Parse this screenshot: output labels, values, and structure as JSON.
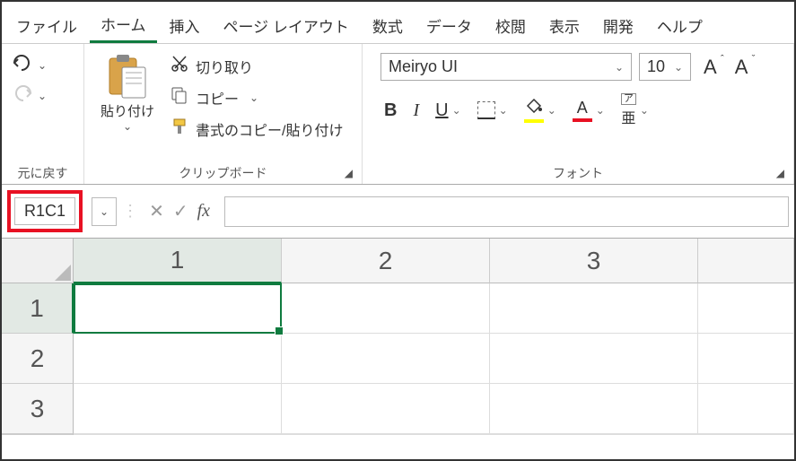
{
  "menubar": {
    "items": [
      {
        "label": "ファイル"
      },
      {
        "label": "ホーム",
        "active": true
      },
      {
        "label": "挿入"
      },
      {
        "label": "ページ レイアウト"
      },
      {
        "label": "数式"
      },
      {
        "label": "データ"
      },
      {
        "label": "校閲"
      },
      {
        "label": "表示"
      },
      {
        "label": "開発"
      },
      {
        "label": "ヘルプ"
      }
    ]
  },
  "ribbon": {
    "undo": {
      "group_label": "元に戻す"
    },
    "clipboard": {
      "paste_label": "貼り付け",
      "cut_label": "切り取り",
      "copy_label": "コピー",
      "format_painter_label": "書式のコピー/貼り付け",
      "group_label": "クリップボード"
    },
    "font": {
      "font_name": "Meiryo UI",
      "font_size": "10",
      "group_label": "フォント",
      "bold": "B",
      "italic": "I",
      "underline": "U",
      "font_color_letter": "A",
      "phonetic_top": "ア",
      "phonetic_bottom": "亜"
    }
  },
  "formula_bar": {
    "name_box": "R1C1",
    "fx": "fx",
    "formula_value": ""
  },
  "grid": {
    "col_headers": [
      "1",
      "2",
      "3"
    ],
    "row_headers": [
      "1",
      "2",
      "3"
    ],
    "selected_cell": {
      "row": 1,
      "col": 1
    }
  }
}
